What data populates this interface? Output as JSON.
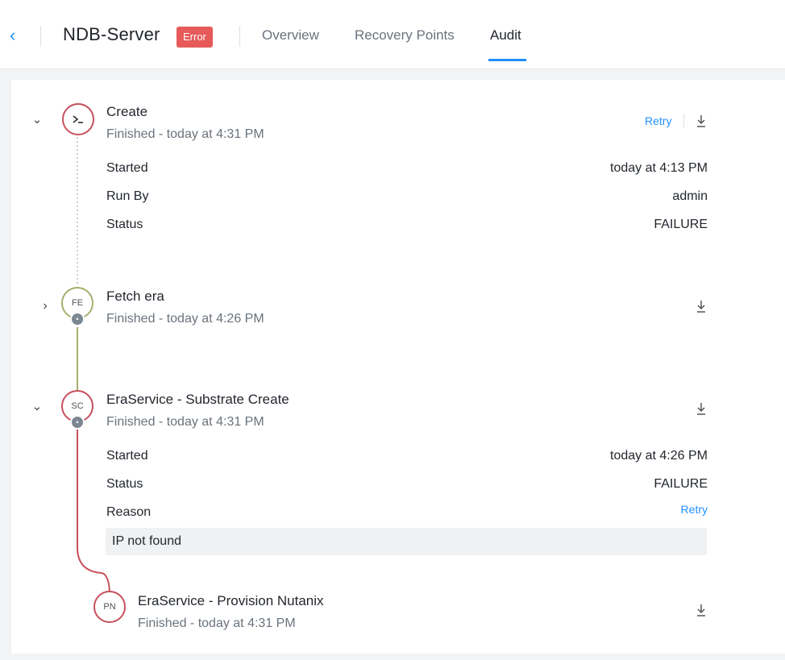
{
  "header": {
    "entity_name": "NDB-Server",
    "status_badge": "Error",
    "tabs": [
      {
        "label": "Overview"
      },
      {
        "label": "Recovery Points"
      },
      {
        "label": "Audit"
      }
    ],
    "active_tab": "Audit"
  },
  "operations": [
    {
      "title": "Create",
      "icon": "terminal-icon",
      "subtitle": "Finished - today at 4:31 PM",
      "action_label": "Retry",
      "details": [
        {
          "label": "Started",
          "value": "today at 4:13 PM"
        },
        {
          "label": "Run By",
          "value": "admin"
        },
        {
          "label": "Status",
          "value": "FAILURE"
        }
      ]
    },
    {
      "title": "Fetch era",
      "initials": "FE",
      "subtitle": "Finished - today at 4:26 PM"
    },
    {
      "title": "EraService - Substrate Create",
      "initials": "SC",
      "subtitle": "Finished - today at 4:31 PM",
      "details": [
        {
          "label": "Started",
          "value": "today at 4:26 PM"
        },
        {
          "label": "Status",
          "value": "FAILURE"
        },
        {
          "label": "Reason",
          "value": "Retry"
        }
      ],
      "reason_text": "IP not found"
    },
    {
      "title": "EraService - Provision Nutanix",
      "initials": "PN",
      "subtitle": "Finished - today at 4:31 PM"
    }
  ],
  "colors": {
    "accent": "#1f8fff",
    "error": "#e65a5a",
    "failed_node": "#c8505e",
    "success_node": "#a7ad6d"
  }
}
